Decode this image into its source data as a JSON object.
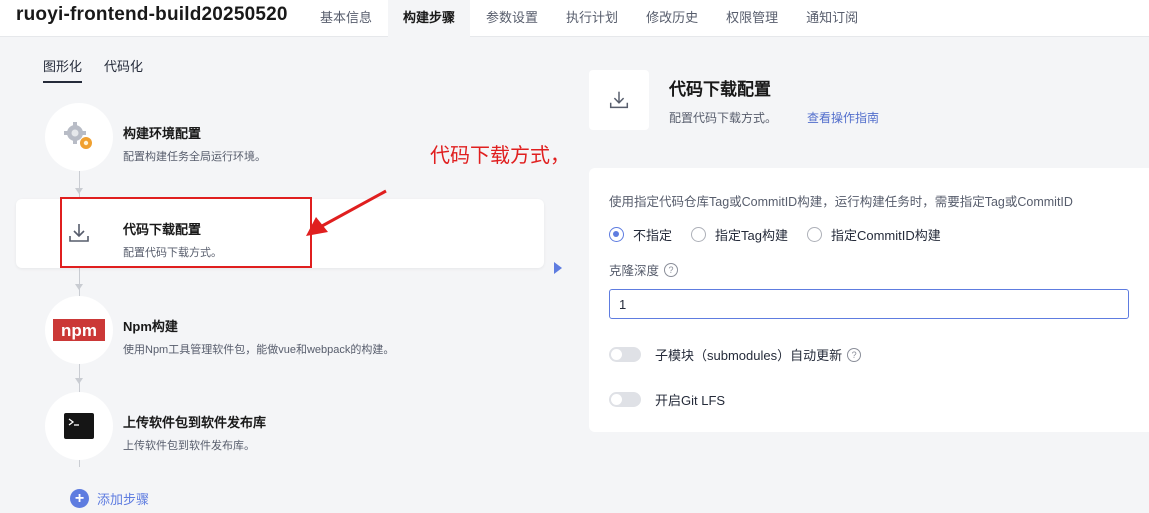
{
  "project": {
    "title": "ruoyi-frontend-build20250520"
  },
  "tabs": [
    {
      "label": "基本信息"
    },
    {
      "label": "构建步骤",
      "active": true
    },
    {
      "label": "参数设置"
    },
    {
      "label": "执行计划"
    },
    {
      "label": "修改历史"
    },
    {
      "label": "权限管理"
    },
    {
      "label": "通知订阅"
    }
  ],
  "mode_tabs": [
    {
      "label": "图形化",
      "active": true
    },
    {
      "label": "代码化"
    }
  ],
  "steps": [
    {
      "title": "构建环境配置",
      "desc": "配置构建任务全局运行环境。",
      "icon": "gear-icon"
    },
    {
      "title": "代码下载配置",
      "desc": "配置代码下载方式。",
      "icon": "download-icon",
      "selected": true
    },
    {
      "title": "Npm构建",
      "desc": "使用Npm工具管理软件包，能做vue和webpack的构建。",
      "icon": "npm-logo-icon",
      "logo_text": "npm"
    },
    {
      "title": "上传软件包到软件发布库",
      "desc": "上传软件包到软件发布库。",
      "icon": "terminal-icon"
    }
  ],
  "add_step": {
    "label": "添加步骤"
  },
  "annotation": {
    "text": "代码下载方式，一般选择默认配置即可",
    "color": "#e01f1f"
  },
  "detail": {
    "title": "代码下载配置",
    "desc": "配置代码下载方式。",
    "guide_link": "查看操作指南",
    "hint": "使用指定代码仓库Tag或CommitID构建，运行构建任务时，需要指定Tag或CommitID",
    "radio_options": [
      {
        "label": "不指定",
        "checked": true
      },
      {
        "label": "指定Tag构建"
      },
      {
        "label": "指定CommitID构建"
      }
    ],
    "clone_depth": {
      "label": "克隆深度",
      "value": "1"
    },
    "toggles": [
      {
        "label": "子模块（submodules）自动更新",
        "help": true,
        "on": false
      },
      {
        "label": "开启Git LFS",
        "help": false,
        "on": false
      }
    ]
  },
  "colors": {
    "accent": "#5e7ce0",
    "annotation_red": "#e01f1f",
    "npm_red": "#cb3837"
  }
}
